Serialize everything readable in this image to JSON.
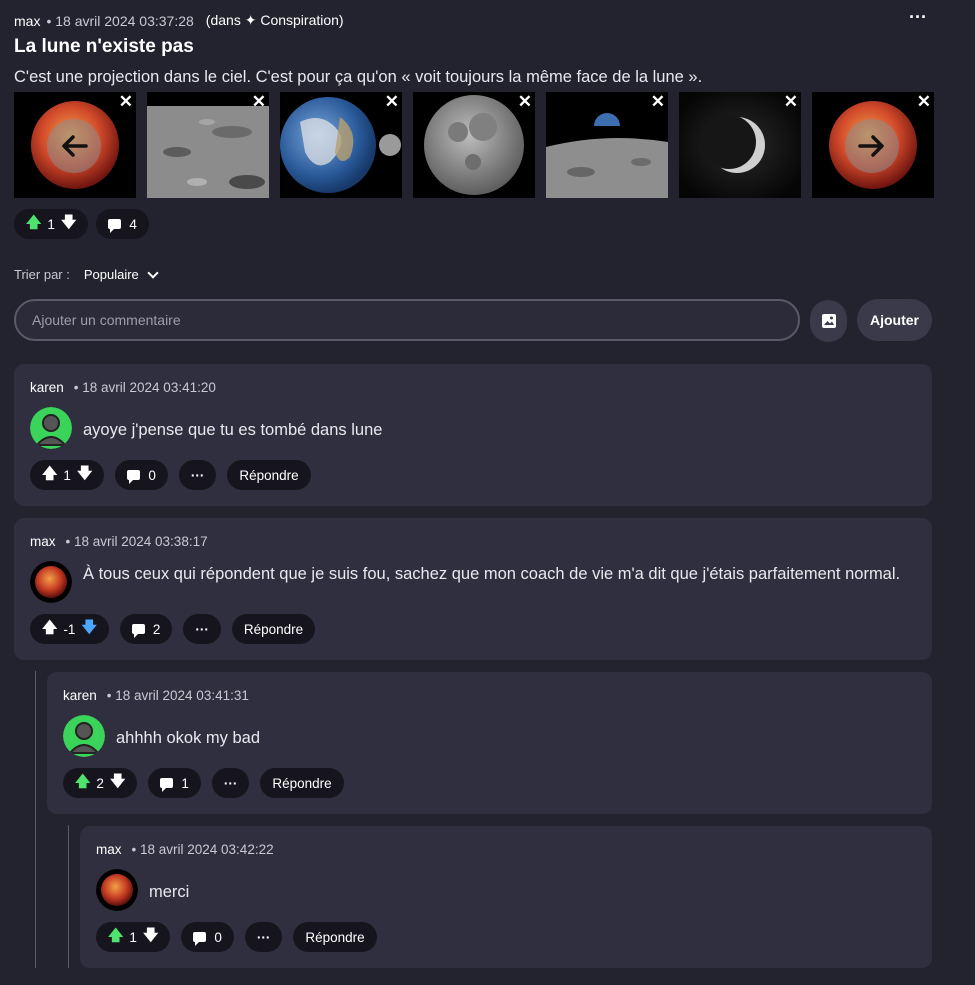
{
  "post": {
    "author": "max",
    "date": "• 18 avril 2024 03:37:28",
    "community": "(dans ✦ Conspiration)",
    "more_label": "···",
    "title": "La lune n'existe pas",
    "body": "C'est une projection dans le ciel. C'est pour ça qu'on « voit toujours la même face de la lune ».",
    "votes": "1",
    "comment_count": "4",
    "close_label": "✕"
  },
  "sort": {
    "label": "Trier par :",
    "value": "Populaire"
  },
  "composer": {
    "placeholder": "Ajouter un commentaire",
    "add_label": "Ajouter"
  },
  "reply_label": "Répondre",
  "more_label": "···",
  "comments": [
    {
      "author": "karen",
      "date": "• 18 avril 2024 03:41:20",
      "text": "ayoye j'pense que tu es tombé dans lune",
      "votes": "1",
      "replies": "0"
    },
    {
      "author": "max",
      "date": "• 18 avril 2024 03:38:17",
      "text": "À tous ceux qui répondent que je suis fou, sachez que mon coach de vie m'a dit que j'étais parfaitement normal.",
      "votes": "-1",
      "replies": "2"
    },
    {
      "author": "karen",
      "date": "• 18 avril 2024 03:41:31",
      "text": "ahhhh okok my bad",
      "votes": "2",
      "replies": "1"
    },
    {
      "author": "max",
      "date": "• 18 avril 2024 03:42:22",
      "text": "merci",
      "votes": "1",
      "replies": "0"
    }
  ],
  "colors": {
    "background": "#23222f",
    "card": "#302f3f",
    "upvote_active": "#4ee36c",
    "downvote_active": "#4aa8ff",
    "avatar_green": "#3bd45a"
  },
  "icons": [
    "ellipsis-icon",
    "close-icon",
    "arrow-left-icon",
    "arrow-right-icon",
    "arrow-up-icon",
    "arrow-down-icon",
    "comment-icon",
    "chevron-down-icon",
    "image-icon",
    "avatar-user-icon",
    "avatar-moon-icon"
  ]
}
